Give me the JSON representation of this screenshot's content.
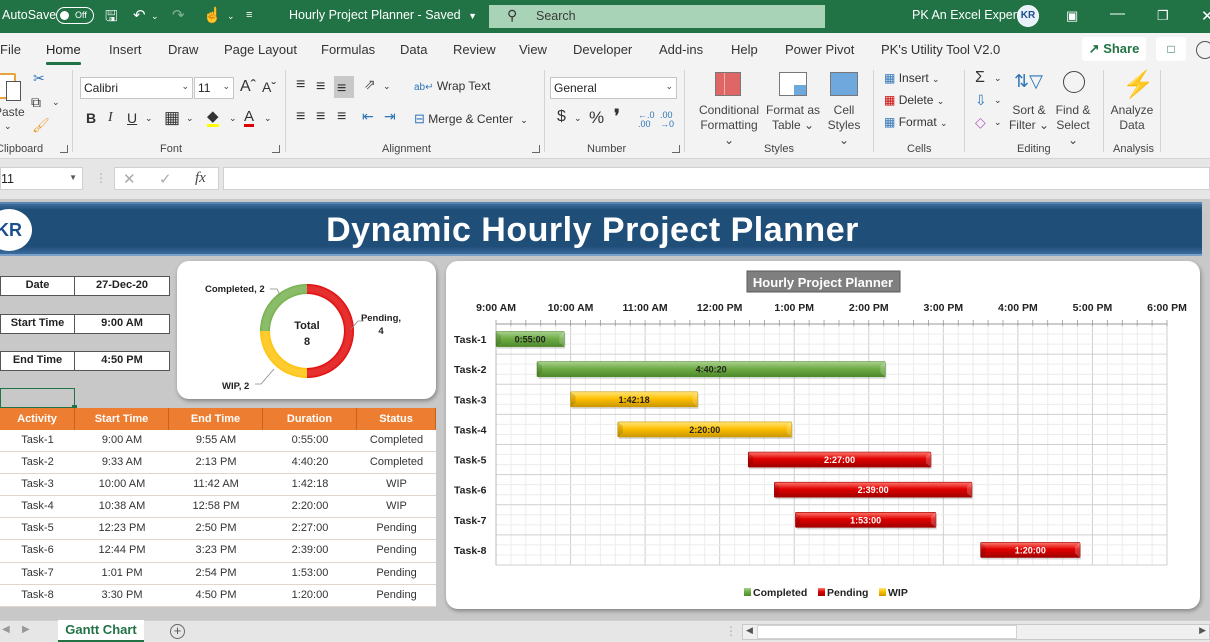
{
  "titlebar": {
    "autosave_label": "AutoSave",
    "autosave_state": "Off",
    "document_title": "Hourly Project Planner",
    "save_state": "Saved",
    "search_placeholder": "Search",
    "user_name": "PK An Excel Expert",
    "avatar_text": "KR"
  },
  "menu": {
    "tabs": [
      "File",
      "Home",
      "Insert",
      "Draw",
      "Page Layout",
      "Formulas",
      "Data",
      "Review",
      "View",
      "Developer",
      "Add-ins",
      "Help",
      "Power Pivot",
      "PK's Utility Tool V2.0"
    ],
    "active": "Home",
    "share_label": "Share"
  },
  "ribbon": {
    "clipboard": {
      "paste_label": "Paste",
      "group_label": "Clipboard"
    },
    "font": {
      "font_name": "Calibri",
      "font_size": "11",
      "group_label": "Font",
      "bold": "B",
      "italic": "I",
      "underline": "U",
      "fill_color": "#ffff00",
      "font_color": "#e00000"
    },
    "alignment": {
      "wrap_text": "Wrap Text",
      "merge_center": "Merge & Center",
      "group_label": "Alignment"
    },
    "number": {
      "format": "General",
      "currency": "$",
      "percent": "%",
      "comma": "❜",
      "group_label": "Number"
    },
    "styles": {
      "conditional": [
        "Conditional",
        "Formatting"
      ],
      "format_table": [
        "Format as",
        "Table"
      ],
      "cell_styles": [
        "Cell",
        "Styles"
      ],
      "group_label": "Styles"
    },
    "cells": {
      "insert": "Insert",
      "delete": "Delete",
      "format": "Format",
      "group_label": "Cells"
    },
    "editing": {
      "sort_filter": [
        "Sort &",
        "Filter"
      ],
      "find_select": [
        "Find &",
        "Select"
      ],
      "group_label": "Editing"
    },
    "analysis": {
      "analyze": [
        "Analyze",
        "Data"
      ],
      "group_label": "Analysis"
    }
  },
  "formula_bar": {
    "name_box": "11",
    "cancel_icon": "✕",
    "enter_icon": "✓",
    "fx_label": "fx",
    "formula": ""
  },
  "sheet": {
    "banner_title": "Dynamic Hourly Project Planner",
    "logo_text": "KR",
    "info": [
      {
        "label": "Date",
        "value": "27-Dec-20"
      },
      {
        "label": "Start Time",
        "value": "9:00 AM"
      },
      {
        "label": "End Time",
        "value": "4:50 PM"
      }
    ],
    "table": {
      "headers": [
        "Activity",
        "Start Time",
        "End Time",
        "Duration",
        "Status"
      ],
      "rows": [
        [
          "Task-1",
          "9:00 AM",
          "9:55 AM",
          "0:55:00",
          "Completed"
        ],
        [
          "Task-2",
          "9:33 AM",
          "2:13 PM",
          "4:40:20",
          "Completed"
        ],
        [
          "Task-3",
          "10:00 AM",
          "11:42 AM",
          "1:42:18",
          "WIP"
        ],
        [
          "Task-4",
          "10:38 AM",
          "12:58 PM",
          "2:20:00",
          "WIP"
        ],
        [
          "Task-5",
          "12:23 PM",
          "2:50 PM",
          "2:27:00",
          "Pending"
        ],
        [
          "Task-6",
          "12:44 PM",
          "3:23 PM",
          "2:39:00",
          "Pending"
        ],
        [
          "Task-7",
          "1:01 PM",
          "2:54 PM",
          "1:53:00",
          "Pending"
        ],
        [
          "Task-8",
          "3:30 PM",
          "4:50 PM",
          "1:20:00",
          "Pending"
        ]
      ]
    }
  },
  "colors": {
    "excel_green": "#217346",
    "banner_blue": "#1f4e79",
    "table_header": "#ed7d31",
    "completed": "#70ad47",
    "pending": "#e00000",
    "wip": "#ffc000"
  },
  "chart_data": [
    {
      "type": "pie",
      "subtype": "doughnut",
      "center_label": "Total",
      "center_value": "8",
      "categories": [
        "Completed",
        "Pending",
        "WIP"
      ],
      "values": [
        2,
        4,
        2
      ],
      "data_labels": [
        "Completed, 2",
        "Pending, 4",
        "WIP, 2"
      ],
      "colors": [
        "#70ad47",
        "#e00000",
        "#ffc000"
      ]
    },
    {
      "type": "bar",
      "subtype": "gantt",
      "title": "Hourly Project Planner",
      "x_ticks": [
        "9:00 AM",
        "10:00 AM",
        "11:00 AM",
        "12:00 PM",
        "1:00 PM",
        "2:00 PM",
        "3:00 PM",
        "4:00 PM",
        "5:00 PM",
        "6:00 PM"
      ],
      "x_range_hours": [
        9,
        18
      ],
      "grid": true,
      "legend": {
        "position": "bottom",
        "entries": [
          "Completed",
          "Pending",
          "WIP"
        ]
      },
      "categories": [
        "Task-1",
        "Task-2",
        "Task-3",
        "Task-4",
        "Task-5",
        "Task-6",
        "Task-7",
        "Task-8"
      ],
      "tasks": [
        {
          "name": "Task-1",
          "start_hours": 9.0,
          "duration_hours": 0.9167,
          "label": "0:55:00",
          "status": "Completed"
        },
        {
          "name": "Task-2",
          "start_hours": 9.55,
          "duration_hours": 4.6722,
          "label": "4:40:20",
          "status": "Completed"
        },
        {
          "name": "Task-3",
          "start_hours": 10.0,
          "duration_hours": 1.705,
          "label": "1:42:18",
          "status": "WIP"
        },
        {
          "name": "Task-4",
          "start_hours": 10.6333,
          "duration_hours": 2.3333,
          "label": "2:20:00",
          "status": "WIP"
        },
        {
          "name": "Task-5",
          "start_hours": 12.3833,
          "duration_hours": 2.45,
          "label": "2:27:00",
          "status": "Pending"
        },
        {
          "name": "Task-6",
          "start_hours": 12.7333,
          "duration_hours": 2.65,
          "label": "2:39:00",
          "status": "Pending"
        },
        {
          "name": "Task-7",
          "start_hours": 13.0167,
          "duration_hours": 1.8833,
          "label": "1:53:00",
          "status": "Pending"
        },
        {
          "name": "Task-8",
          "start_hours": 15.5,
          "duration_hours": 1.3333,
          "label": "1:20:00",
          "status": "Pending"
        }
      ]
    }
  ],
  "bottom": {
    "sheet_tab": "Gantt Chart",
    "add_sheet": "+"
  }
}
